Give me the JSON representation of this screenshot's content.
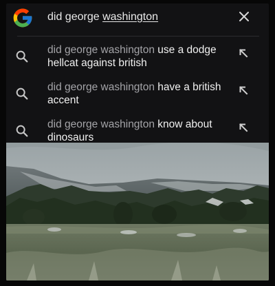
{
  "search": {
    "query_prefix": "did george ",
    "query_underlined": "washington"
  },
  "suggestions": [
    {
      "base": "did george washington",
      "completion": "use a dodge hellcat against british"
    },
    {
      "base": "did george washington",
      "completion": "have a british accent"
    },
    {
      "base": "did george washington",
      "completion": "know about dinosaurs"
    }
  ],
  "icons": {
    "logo": "google-g-logo",
    "clear": "close-icon",
    "suggestion": "search-icon",
    "fill": "arrow-up-left-icon"
  },
  "colors": {
    "background": "#121214",
    "query_text": "#eaeaea",
    "suggestion_base": "#a4a4a8",
    "suggestion_completion": "#f0f0f0"
  }
}
